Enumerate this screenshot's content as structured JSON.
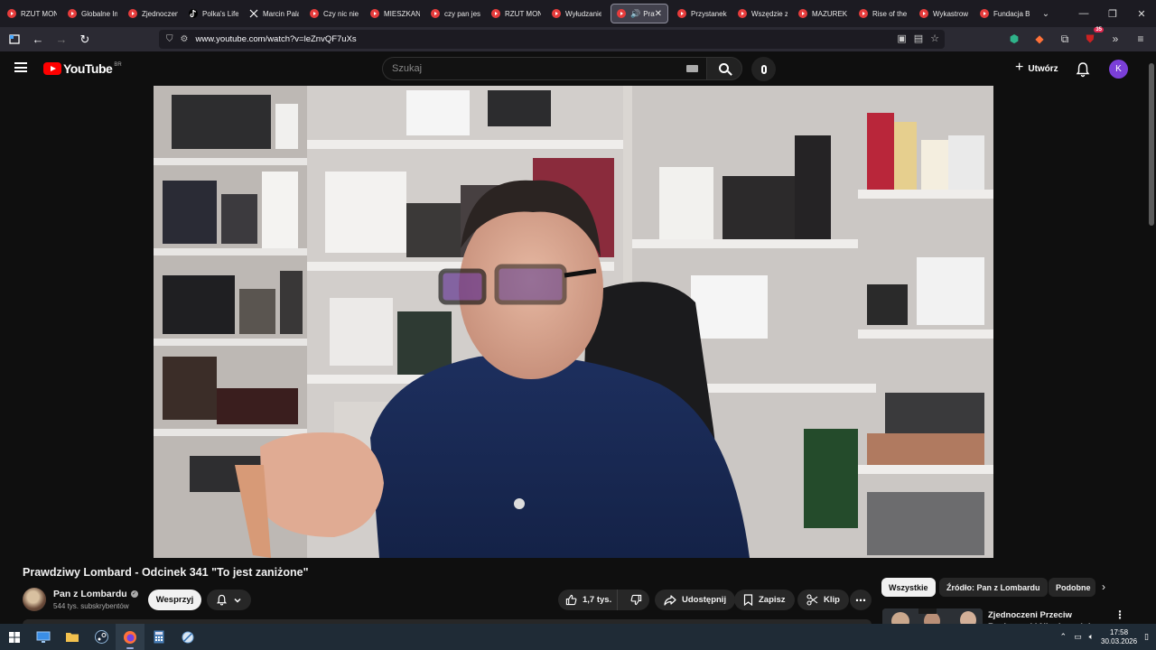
{
  "browser": {
    "tabs": [
      {
        "label": "RZUT MONETĄ",
        "favicon": "youtube-icon"
      },
      {
        "label": "Globalne Imperium",
        "favicon": "youtube-icon"
      },
      {
        "label": "Zjednoczeni",
        "favicon": "youtube-icon"
      },
      {
        "label": "Polka's Life",
        "favicon": "tiktok-icon"
      },
      {
        "label": "Marcin Pala",
        "favicon": "x-icon"
      },
      {
        "label": "Czy nic nie",
        "favicon": "youtube-icon"
      },
      {
        "label": "MIESZKANIA",
        "favicon": "youtube-icon"
      },
      {
        "label": "czy pan jest",
        "favicon": "youtube-icon"
      },
      {
        "label": "RZUT MONETĄ",
        "favicon": "youtube-icon"
      },
      {
        "label": "Wyłudzanie",
        "favicon": "youtube-icon"
      },
      {
        "label": "Praw",
        "favicon": "youtube-icon",
        "active": true
      },
      {
        "label": "Przystanek",
        "favicon": "youtube-icon"
      },
      {
        "label": "Wszędzie za",
        "favicon": "youtube-icon"
      },
      {
        "label": "MAZUREK",
        "favicon": "youtube-icon"
      },
      {
        "label": "Rise of the",
        "favicon": "youtube-icon"
      },
      {
        "label": "Wykastrow",
        "favicon": "youtube-icon"
      },
      {
        "label": "Fundacja B",
        "favicon": "youtube-icon"
      }
    ],
    "url": "www.youtube.com/watch?v=leZnvQF7uXs",
    "extension_badge": "35"
  },
  "youtube": {
    "logo_text": "YouTube",
    "country_code": "BR",
    "search_placeholder": "Szukaj",
    "create_label": "Utwórz",
    "avatar_letter": "K"
  },
  "video": {
    "title": "Prawdziwy Lombard - Odcinek 341 \"To jest zaniżone\"",
    "channel_name": "Pan z Lombardu",
    "subscribers": "544 tys. subskrybentów",
    "join_label": "Wesprzyj",
    "likes": "1,7 tys.",
    "share_label": "Udostępnij",
    "save_label": "Zapisz",
    "clip_label": "Klip"
  },
  "chips": [
    {
      "label": "Wszystkie",
      "selected": true
    },
    {
      "label": "Źródło: Pan z Lombardu",
      "selected": false
    },
    {
      "label": "Podobne",
      "selected": false
    }
  ],
  "recommendation": {
    "title": "Zjednoczeni Przeciw Rasizmowi i Nierówności"
  },
  "taskbar": {
    "time": "17:58",
    "date": "30.03.2026"
  }
}
